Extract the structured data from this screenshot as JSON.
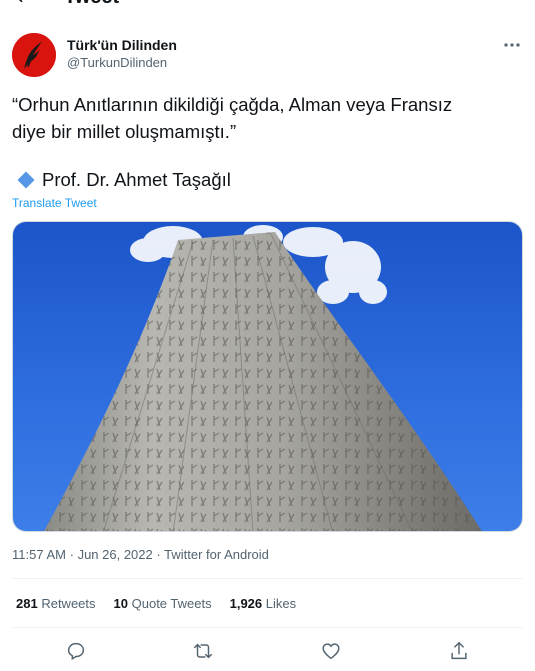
{
  "header": {
    "title": "Tweet"
  },
  "author": {
    "name": "Türk'ün Dilinden",
    "handle": "@TurkunDilinden"
  },
  "tweet": {
    "text": "“Orhun Anıtlarının dikildiği çağda, Alman veya Fransız\ndiye bir millet oluşmamıştı.”",
    "signature": "Prof. Dr. Ahmet Taşağıl",
    "translate_label": "Translate Tweet"
  },
  "media": {
    "description_icon": "stone-monument-image"
  },
  "meta": {
    "time": "11:57 AM",
    "date": "Jun 26, 2022",
    "source": "Twitter for Android",
    "separator": "·"
  },
  "stats": [
    {
      "count": "281",
      "label": "Retweets"
    },
    {
      "count": "10",
      "label": "Quote Tweets"
    },
    {
      "count": "1,926",
      "label": "Likes"
    }
  ],
  "colors": {
    "accent": "#1d9bf0",
    "avatar": "#d9140f",
    "sky": "#1f5fd0"
  }
}
